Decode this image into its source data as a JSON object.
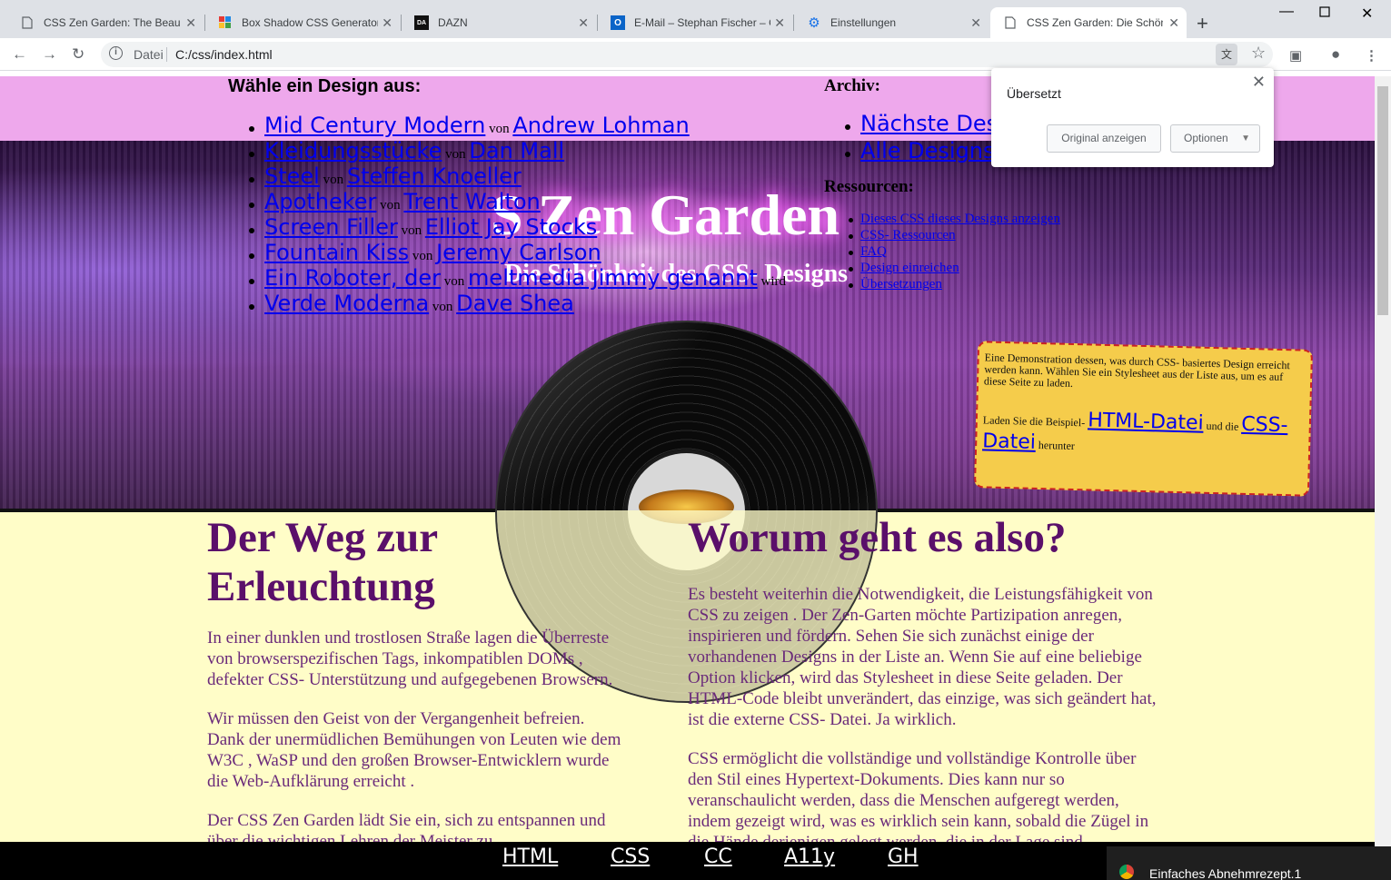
{
  "browser": {
    "tabs": [
      {
        "title": "CSS Zen Garden: The Beauty",
        "icon": "page-icon"
      },
      {
        "title": "Box Shadow CSS Generator |",
        "icon": "cssmatic-icon"
      },
      {
        "title": "DAZN",
        "icon": "dazn-icon"
      },
      {
        "title": "E-Mail – Stephan Fischer – O",
        "icon": "outlook-icon"
      },
      {
        "title": "Einstellungen",
        "icon": "gear-icon"
      },
      {
        "title": "CSS Zen Garden: Die Schönh",
        "icon": "page-icon",
        "active": true
      }
    ],
    "address": {
      "scheme": "Datei",
      "url": "C:/css/index.html"
    },
    "translate_popup": {
      "title": "Übersetzt",
      "show_original": "Original anzeigen",
      "options": "Optionen"
    }
  },
  "page": {
    "choose_heading": "Wähle ein Design aus:",
    "designs": [
      {
        "name": "Mid Century Modern",
        "by": "von",
        "author": "Andrew Lohman",
        "suffix": ""
      },
      {
        "name": "Kleidungsstücke",
        "by": "von",
        "author": "Dan Mall",
        "suffix": ""
      },
      {
        "name": "Steel",
        "by": "von",
        "author": "Steffen Knoeller",
        "suffix": ""
      },
      {
        "name": "Apotheker",
        "by": "von",
        "author": "Trent Walton",
        "suffix": ""
      },
      {
        "name": "Screen Filler",
        "by": "von",
        "author": "Elliot Jay Stocks",
        "suffix": ""
      },
      {
        "name": "Fountain Kiss",
        "by": "von",
        "author": "Jeremy Carlson",
        "suffix": ""
      },
      {
        "name": "Ein Roboter, der",
        "by": "von",
        "author": "meltmedia Jimmy genannt",
        "suffix": "wird"
      },
      {
        "name": "Verde Moderna",
        "by": "von",
        "author": "Dave Shea",
        "suffix": ""
      }
    ],
    "archive_heading": "Archiv:",
    "archive": [
      "Nächste Des",
      "Alle Designs"
    ],
    "resources_heading": "Ressourcen:",
    "resources": [
      "Dieses CSS dieses Designs anzeigen",
      "CSS- Ressourcen",
      "FAQ",
      "Design einreichen",
      "Übersetzungen"
    ],
    "hero_title": "S Zen Garden",
    "hero_subtitle": "Die Schönheit des CSS- Designs",
    "intro": {
      "p1": "Eine Demonstration dessen, was durch CSS- basiertes Design erreicht werden kann. Wählen Sie ein Stylesheet aus der Liste aus, um es auf diese Seite zu laden.",
      "p2_pre": "Laden Sie die Beispiel-",
      "html_link": "HTML-Datei",
      "p2_mid": "und die",
      "css_link": "CSS-Datei",
      "p2_post": "herunter"
    },
    "left": {
      "heading": "Der Weg zur Erleuchtung",
      "p1": "In einer dunklen und trostlosen Straße lagen die Überreste von browserspezifischen Tags, inkompatiblen DOMs , defekter CSS- Unterstützung und aufgegebenen Browsern.",
      "p2": "Wir müssen den Geist von der Vergangenheit befreien. Dank der unermüdlichen Bemühungen von Leuten wie dem W3C , WaSP und den großen Browser-Entwicklern wurde die Web-Aufklärung erreicht .",
      "p3": "Der CSS Zen Garden lädt Sie ein, sich zu entspannen und über die wichtigen Lehren der Meister zu"
    },
    "right": {
      "heading": "Worum geht es also?",
      "p1": "Es besteht weiterhin die Notwendigkeit, die Leistungsfähigkeit von CSS zu zeigen . Der Zen-Garten möchte Partizipation anregen, inspirieren und fördern. Sehen Sie sich zunächst einige der vorhandenen Designs in der Liste an. Wenn Sie auf eine beliebige Option klicken, wird das Stylesheet in diese Seite geladen. Der HTML-Code bleibt unverändert, das einzige, was sich geändert hat, ist die externe CSS- Datei. Ja wirklich.",
      "p2": "CSS ermöglicht die vollständige und vollständige Kontrolle über den Stil eines Hypertext-Dokuments. Dies kann nur so veranschaulicht werden, dass die Menschen aufgeregt werden, indem gezeigt wird, was es wirklich sein kann, sobald die Zügel in die Hände derjenigen gelegt werden, die in der Lage sind"
    },
    "footer": [
      "HTML",
      "CSS",
      "CC",
      "A11y",
      "GH"
    ]
  },
  "notification": "Einfaches Abnehmrezept.1"
}
